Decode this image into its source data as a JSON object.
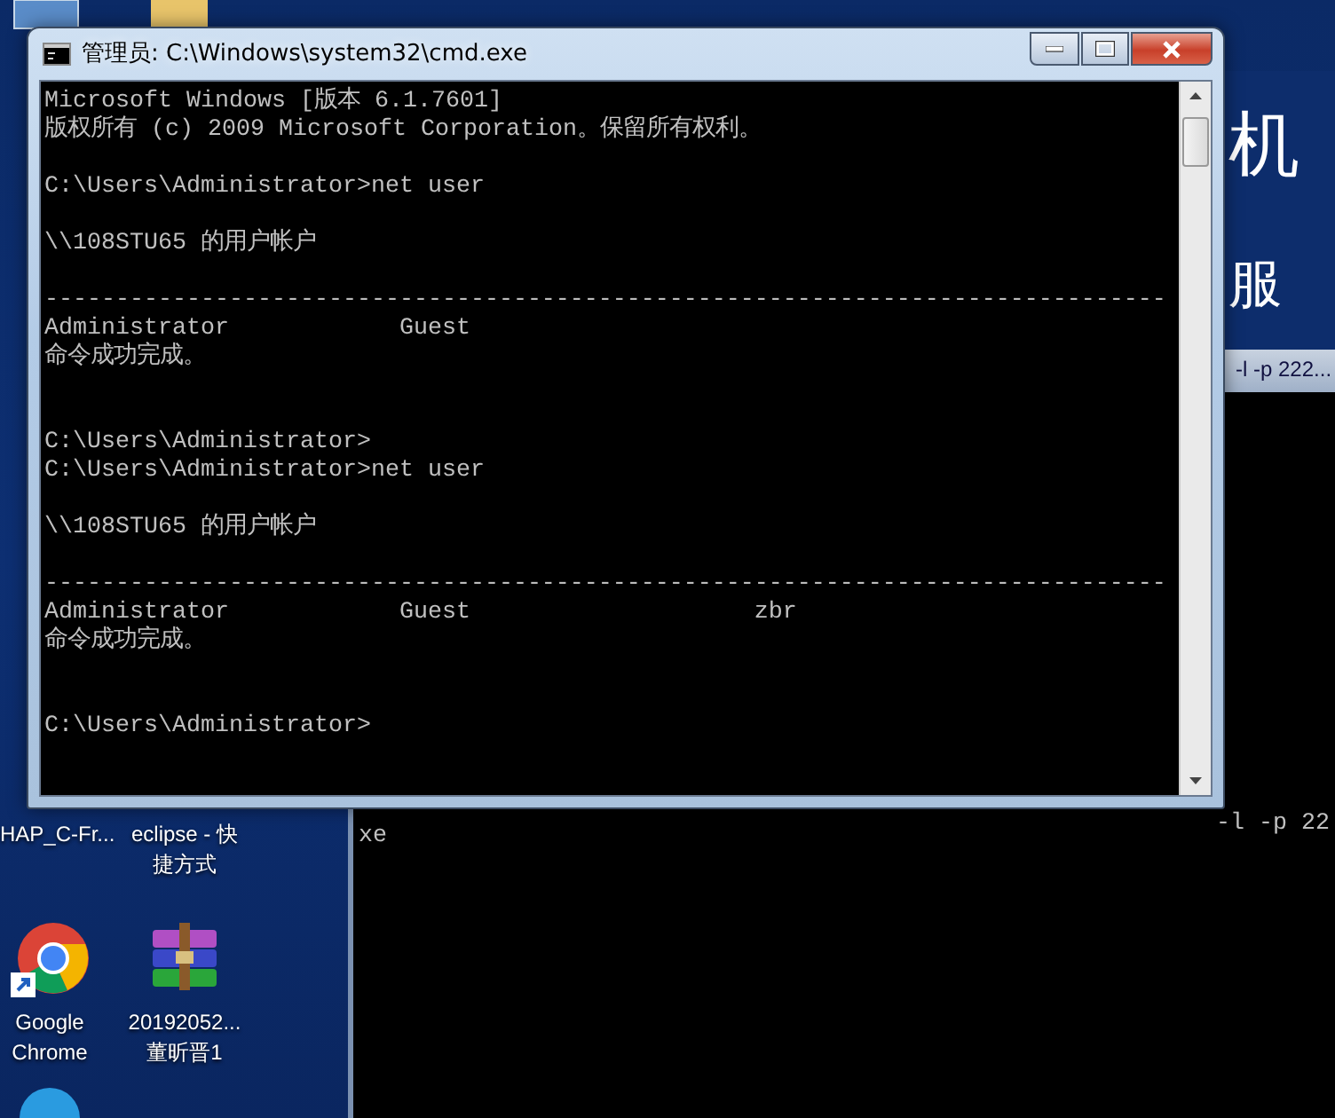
{
  "desktop": {
    "icons": [
      {
        "kind": "folder",
        "label_lines": [
          "HAP_C-Fr..."
        ]
      },
      {
        "kind": "shortcut",
        "label_lines": [
          "eclipse - 快",
          "捷方式"
        ]
      },
      {
        "kind": "chrome",
        "label_lines": [
          "Google",
          "Chrome"
        ]
      },
      {
        "kind": "archive",
        "label_lines": [
          "20192052...",
          "董昕晋1"
        ]
      }
    ]
  },
  "background_page": {
    "headings": [
      "机",
      "服"
    ]
  },
  "back_console": {
    "title": "-l -p 222...",
    "lines": [
      {
        "kind": "text",
        "text": "-l -p 22"
      },
      {
        "kind": "text",
        "text": "xe"
      }
    ]
  },
  "window": {
    "title": "管理员: C:\\Windows\\system32\\cmd.exe",
    "lines": [
      {
        "kind": "text",
        "text": "Microsoft Windows [版本 6.1.7601]"
      },
      {
        "kind": "text",
        "text": "版权所有 (c) 2009 Microsoft Corporation。保留所有权利。"
      },
      {
        "kind": "blank"
      },
      {
        "kind": "text",
        "text": "C:\\Users\\Administrator>net user"
      },
      {
        "kind": "blank"
      },
      {
        "kind": "text",
        "text": "\\\\108STU65 的用户帐户"
      },
      {
        "kind": "blank"
      },
      {
        "kind": "text",
        "text": "-------------------------------------------------------------------------------"
      },
      {
        "kind": "text",
        "text": "Administrator            Guest"
      },
      {
        "kind": "text",
        "text": "命令成功完成。"
      },
      {
        "kind": "blank"
      },
      {
        "kind": "blank"
      },
      {
        "kind": "text",
        "text": "C:\\Users\\Administrator>"
      },
      {
        "kind": "text",
        "text": "C:\\Users\\Administrator>net user"
      },
      {
        "kind": "blank"
      },
      {
        "kind": "text",
        "text": "\\\\108STU65 的用户帐户"
      },
      {
        "kind": "blank"
      },
      {
        "kind": "text",
        "text": "-------------------------------------------------------------------------------"
      },
      {
        "kind": "text",
        "text": "Administrator            Guest                    zbr"
      },
      {
        "kind": "text",
        "text": "命令成功完成。"
      },
      {
        "kind": "blank"
      },
      {
        "kind": "blank"
      },
      {
        "kind": "text",
        "text": "C:\\Users\\Administrator>"
      }
    ]
  }
}
